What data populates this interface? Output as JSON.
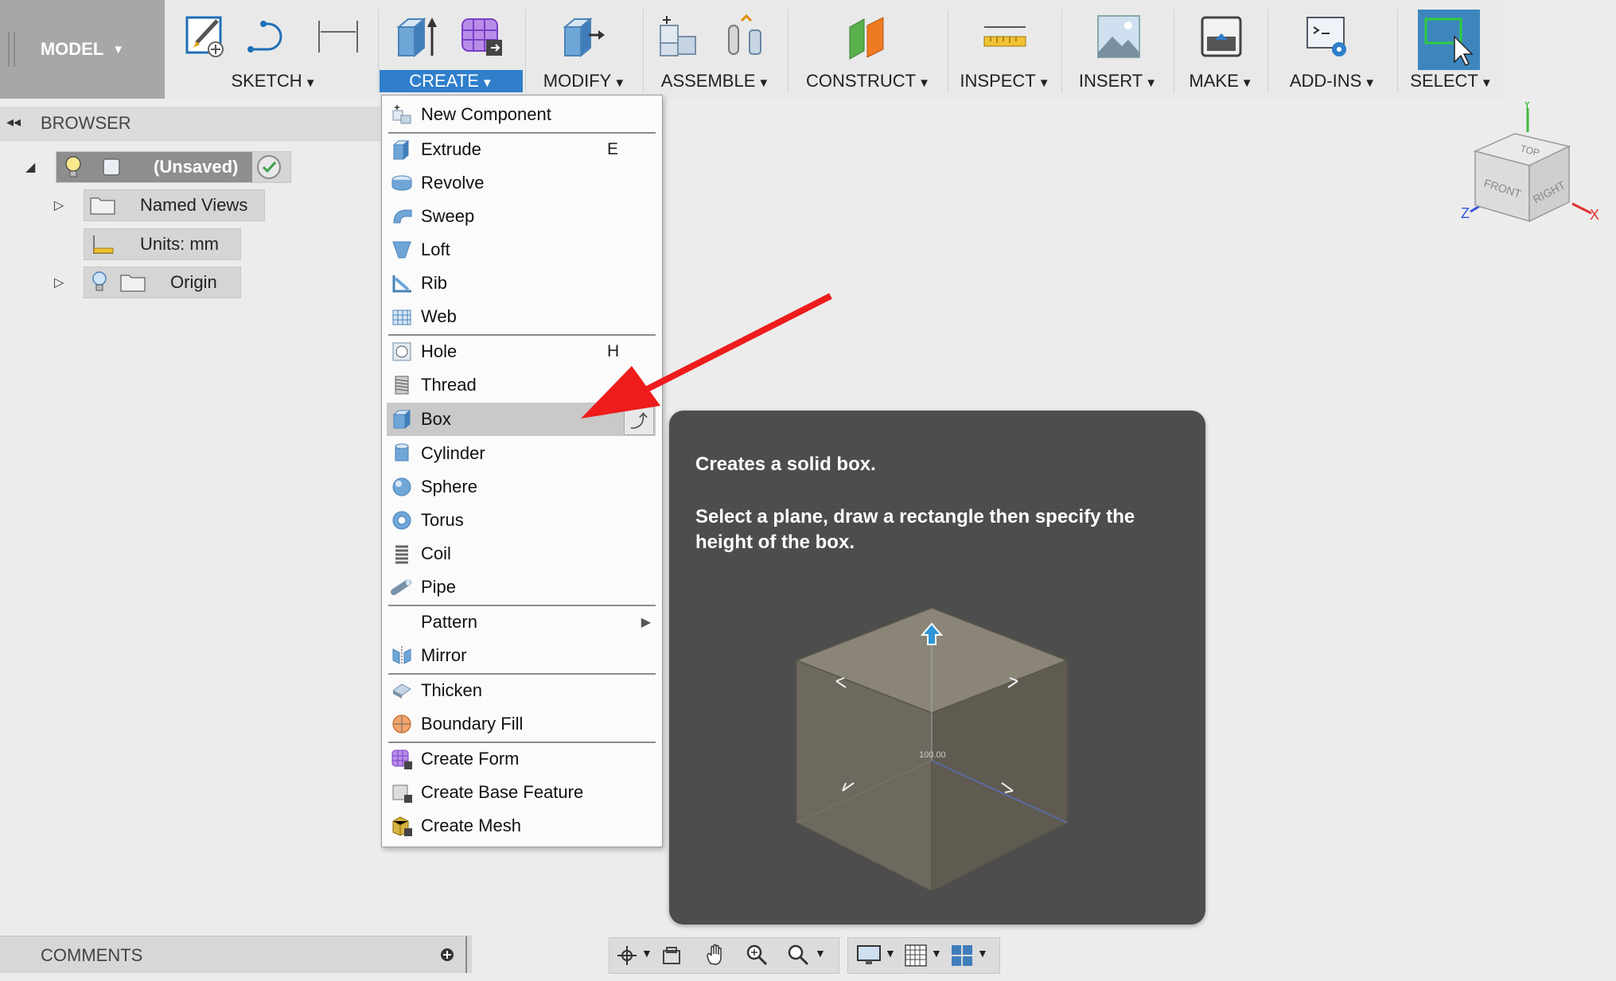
{
  "toolbar": {
    "workspace": "MODEL",
    "groups": [
      {
        "label": "SKETCH"
      },
      {
        "label": "CREATE"
      },
      {
        "label": "MODIFY"
      },
      {
        "label": "ASSEMBLE"
      },
      {
        "label": "CONSTRUCT"
      },
      {
        "label": "INSPECT"
      },
      {
        "label": "INSERT"
      },
      {
        "label": "MAKE"
      },
      {
        "label": "ADD-INS"
      },
      {
        "label": "SELECT"
      }
    ]
  },
  "browser": {
    "title": "BROWSER",
    "root": "(Unsaved)",
    "items": [
      {
        "label": "Named Views"
      },
      {
        "label": "Units: mm"
      },
      {
        "label": "Origin"
      }
    ]
  },
  "create_menu": {
    "items": [
      {
        "label": "New Component",
        "shortcut": ""
      },
      {
        "label": "Extrude",
        "shortcut": "E"
      },
      {
        "label": "Revolve",
        "shortcut": ""
      },
      {
        "label": "Sweep",
        "shortcut": ""
      },
      {
        "label": "Loft",
        "shortcut": ""
      },
      {
        "label": "Rib",
        "shortcut": ""
      },
      {
        "label": "Web",
        "shortcut": ""
      },
      {
        "label": "Hole",
        "shortcut": "H"
      },
      {
        "label": "Thread",
        "shortcut": ""
      },
      {
        "label": "Box",
        "shortcut": ""
      },
      {
        "label": "Cylinder",
        "shortcut": ""
      },
      {
        "label": "Sphere",
        "shortcut": ""
      },
      {
        "label": "Torus",
        "shortcut": ""
      },
      {
        "label": "Coil",
        "shortcut": ""
      },
      {
        "label": "Pipe",
        "shortcut": ""
      },
      {
        "label": "Pattern",
        "shortcut": ""
      },
      {
        "label": "Mirror",
        "shortcut": ""
      },
      {
        "label": "Thicken",
        "shortcut": ""
      },
      {
        "label": "Boundary Fill",
        "shortcut": ""
      },
      {
        "label": "Create Form",
        "shortcut": ""
      },
      {
        "label": "Create Base Feature",
        "shortcut": ""
      },
      {
        "label": "Create Mesh",
        "shortcut": ""
      }
    ],
    "highlighted": "Box"
  },
  "tooltip": {
    "heading": "Creates a solid box.",
    "description": "Select a plane, draw a rectangle then specify the height of the box.",
    "dimension": "100.00"
  },
  "viewcube": {
    "top": "TOP",
    "front": "FRONT",
    "right": "RIGHT",
    "x": "X",
    "y": "Y",
    "z": "Z"
  },
  "comments": {
    "title": "COMMENTS"
  },
  "colors": {
    "accent": "#2f7fcb",
    "arrow": "#ee1c1c",
    "tooltip_bg": "#4d4d4d"
  }
}
